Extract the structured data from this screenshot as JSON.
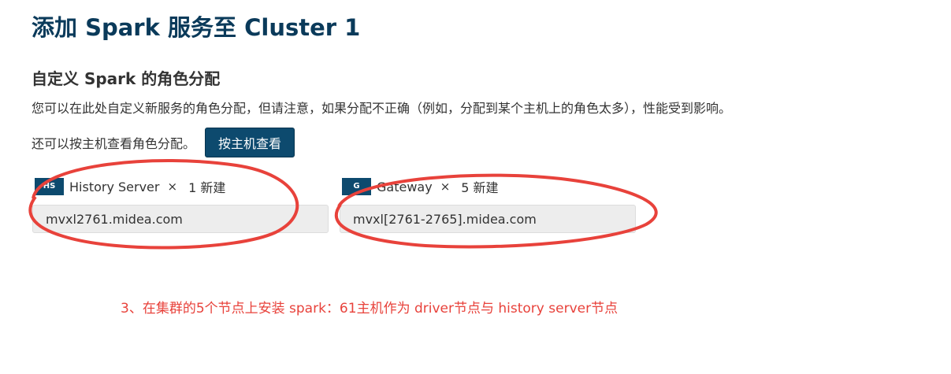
{
  "page": {
    "title": "添加 Spark 服务至 Cluster 1"
  },
  "section": {
    "title": "自定义 Spark 的角色分配",
    "description": "您可以在此处自定义新服务的角色分配，但请注意，如果分配不正确（例如，分配到某个主机上的角色太多），性能受到影响。",
    "host_view_text": "还可以按主机查看角色分配。",
    "host_view_button": "按主机查看"
  },
  "roles": [
    {
      "badge": "HS",
      "name": "History Server",
      "times": "×",
      "count": "1 新建",
      "hosts": "mvxl2761.midea.com"
    },
    {
      "badge": "G",
      "name": "Gateway",
      "times": "×",
      "count": "5 新建",
      "hosts": "mvxl[2761-2765].midea.com"
    }
  ],
  "annotation": {
    "text": "3、在集群的5个节点上安装 spark：61主机作为 driver节点与 history server节点",
    "color": "#e8423b"
  },
  "colors": {
    "title": "#0a3a5a",
    "button_bg": "#0d4a6e",
    "badge_bg": "#0d4a6e",
    "host_field_bg": "#ededed",
    "annotation_red": "#e8423b"
  }
}
